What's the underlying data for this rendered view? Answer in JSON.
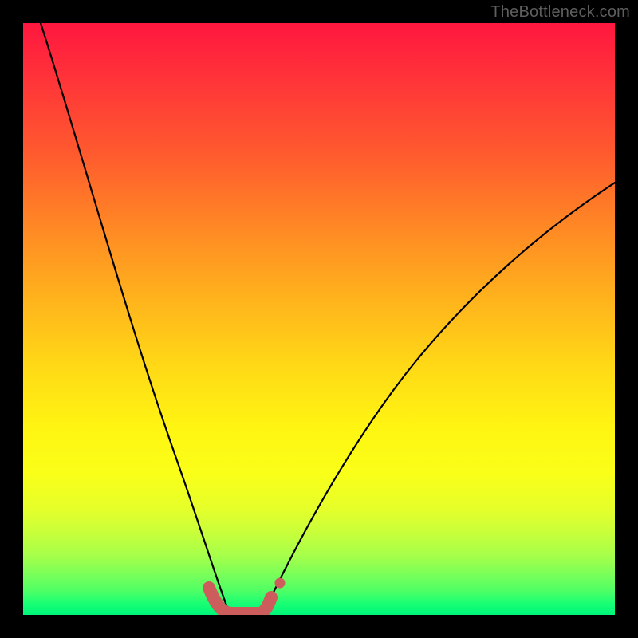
{
  "watermark": {
    "text": "TheBottleneck.com"
  },
  "chart_data": {
    "type": "line",
    "title": "",
    "xlabel": "",
    "ylabel": "",
    "xlim": [
      0,
      100
    ],
    "ylim": [
      0,
      100
    ],
    "grid": false,
    "legend": "none",
    "gradient": {
      "direction": "top-to-bottom",
      "description": "red (mismatch) at top through yellow to green (optimal) at bottom",
      "stops": [
        {
          "pos": 0,
          "color": "#ff173f"
        },
        {
          "pos": 50,
          "color": "#ffd916"
        },
        {
          "pos": 80,
          "color": "#faff18"
        },
        {
          "pos": 100,
          "color": "#00f57a"
        }
      ]
    },
    "series": [
      {
        "name": "bottleneck-curve-left",
        "stroke": "#000000",
        "x": [
          3,
          6,
          9,
          12,
          15,
          18,
          21,
          24,
          27,
          30,
          32,
          34
        ],
        "y": [
          100,
          92,
          83,
          74,
          65,
          55,
          45,
          35,
          25,
          14,
          6,
          1
        ]
      },
      {
        "name": "bottleneck-curve-right",
        "stroke": "#000000",
        "x": [
          40,
          43,
          46,
          50,
          55,
          60,
          65,
          70,
          75,
          80,
          85,
          90,
          95,
          100
        ],
        "y": [
          1,
          5,
          10,
          17,
          25,
          32,
          39,
          45,
          51,
          56,
          61,
          65,
          69,
          73
        ]
      },
      {
        "name": "optimal-zone",
        "stroke": "#cd5c5c",
        "stroke_width_px": 16,
        "x": [
          31,
          33,
          35,
          37,
          39,
          41
        ],
        "y": [
          5,
          1,
          0,
          0,
          1,
          4
        ]
      },
      {
        "name": "optimal-dot",
        "stroke": "#cd5c5c",
        "type": "scatter",
        "x": [
          43
        ],
        "y": [
          6
        ]
      }
    ],
    "annotations": []
  }
}
